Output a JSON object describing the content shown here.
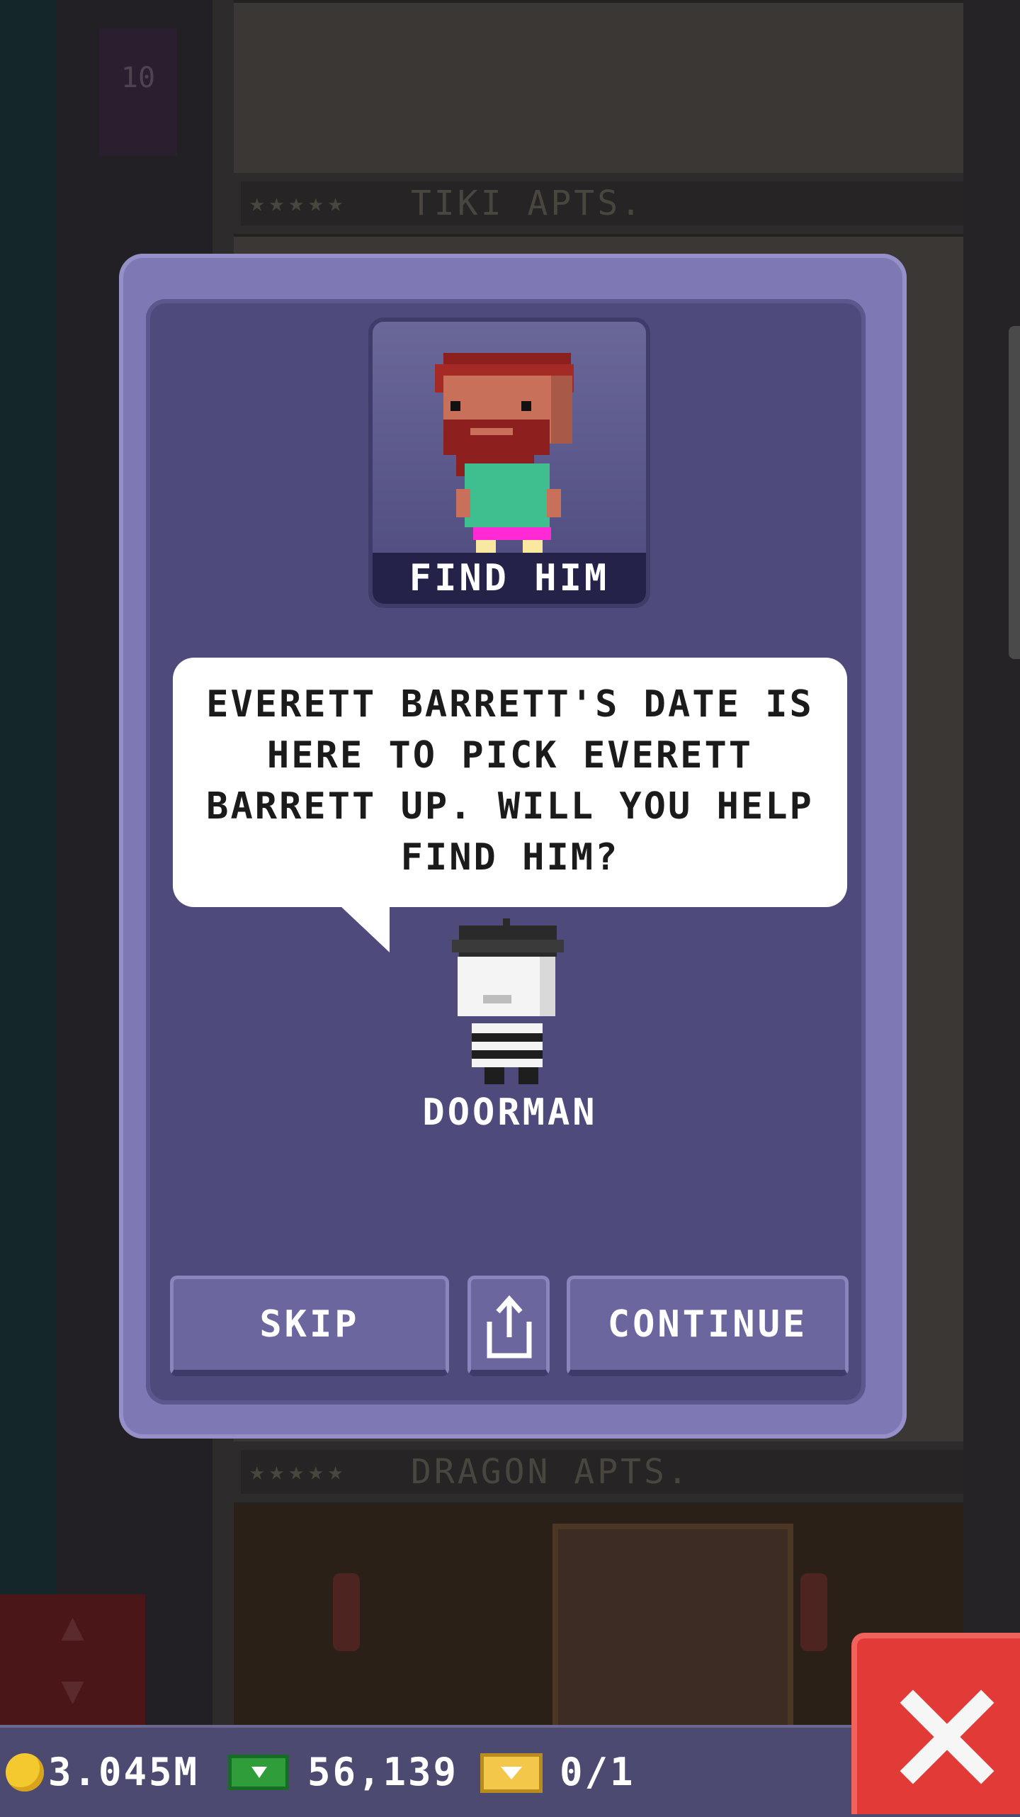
{
  "background": {
    "floor_number": "10",
    "floors": [
      {
        "name": "TIKI APTS.",
        "stars": "★★★★★"
      },
      {
        "name": "DRAGON APTS.",
        "stars": "★★★★★"
      }
    ]
  },
  "dialog": {
    "mission_title": "FIND HIM",
    "message": "EVERETT BARRETT'S DATE IS HERE TO PICK EVERETT BARRETT UP. WILL YOU HELP FIND HIM?",
    "speaker": "DOORMAN",
    "buttons": {
      "skip": "SKIP",
      "continue": "CONTINUE"
    }
  },
  "status_bar": {
    "coins": "3.045M",
    "bux": "56,139",
    "tickets": "0/1"
  },
  "colors": {
    "modal_outer": "#7e78b4",
    "modal_inner": "#4e4b7c",
    "button": "#6b679e",
    "close_button": "#e23a36",
    "status_bar": "#4c4a70"
  },
  "icons": [
    "share-icon",
    "coin-icon",
    "bux-icon",
    "ticket-icon",
    "close-icon",
    "elevator-arrows-icon"
  ]
}
